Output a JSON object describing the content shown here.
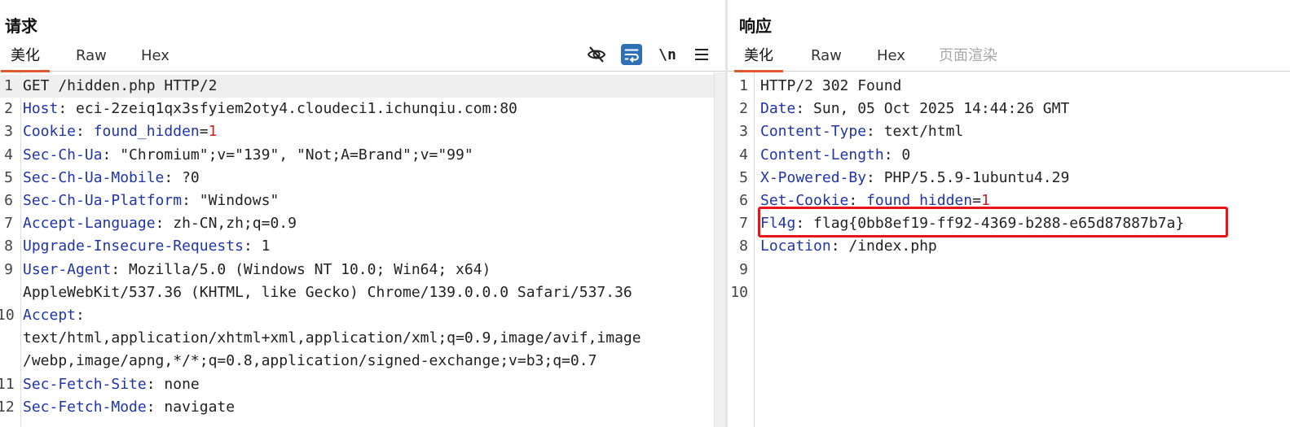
{
  "request": {
    "title": "请求",
    "tabs": [
      {
        "label": "美化",
        "active": true
      },
      {
        "label": "Raw",
        "active": false
      },
      {
        "label": "Hex",
        "active": false
      }
    ],
    "tools": {
      "wrap_newline": "\\n"
    },
    "lines": [
      {
        "num": "1",
        "name": "",
        "value": "GET /hidden.php HTTP/2"
      },
      {
        "num": "2",
        "name": "Host",
        "value": ": eci-2zeiq1qx3sfyiem2oty4.cloudeci1.ichunqiu.com:80"
      },
      {
        "num": "3",
        "name": "Cookie",
        "value": ": ",
        "cookie_name": "found_hidden",
        "cookie_eq": "=",
        "cookie_value": "1"
      },
      {
        "num": "4",
        "name": "Sec-Ch-Ua",
        "value": ": \"Chromium\";v=\"139\", \"Not;A=Brand\";v=\"99\""
      },
      {
        "num": "5",
        "name": "Sec-Ch-Ua-Mobile",
        "value": ": ?0"
      },
      {
        "num": "6",
        "name": "Sec-Ch-Ua-Platform",
        "value": ": \"Windows\""
      },
      {
        "num": "7",
        "name": "Accept-Language",
        "value": ": zh-CN,zh;q=0.9"
      },
      {
        "num": "8",
        "name": "Upgrade-Insecure-Requests",
        "value": ": 1"
      },
      {
        "num": "9",
        "name": "User-Agent",
        "value": ": Mozilla/5.0 (Windows NT 10.0; Win64; x64)",
        "cont": [
          "AppleWebKit/537.36 (KHTML, like Gecko) Chrome/139.0.0.0 Safari/537.36"
        ]
      },
      {
        "num": "10",
        "name": "Accept",
        "value": ":",
        "cont": [
          "text/html,application/xhtml+xml,application/xml;q=0.9,image/avif,image",
          "/webp,image/apng,*/*;q=0.8,application/signed-exchange;v=b3;q=0.7"
        ]
      },
      {
        "num": "11",
        "name": "Sec-Fetch-Site",
        "value": ": none"
      },
      {
        "num": "12",
        "name": "Sec-Fetch-Mode",
        "value": ": navigate"
      }
    ]
  },
  "response": {
    "title": "响应",
    "tabs": [
      {
        "label": "美化",
        "active": true
      },
      {
        "label": "Raw",
        "active": false
      },
      {
        "label": "Hex",
        "active": false
      },
      {
        "label": "页面渲染",
        "active": false,
        "disabled": true
      }
    ],
    "lines": [
      {
        "num": "1",
        "name": "",
        "value": "HTTP/2 302 Found"
      },
      {
        "num": "2",
        "name": "Date",
        "value": ": Sun, 05 Oct 2025 14:44:26 GMT"
      },
      {
        "num": "3",
        "name": "Content-Type",
        "value": ": text/html"
      },
      {
        "num": "4",
        "name": "Content-Length",
        "value": ": 0"
      },
      {
        "num": "5",
        "name": "X-Powered-By",
        "value": ": PHP/5.5.9-1ubuntu4.29"
      },
      {
        "num": "6",
        "name": "Set-Cookie",
        "value": ": ",
        "cookie_name": "found_hidden",
        "cookie_eq": "=",
        "cookie_value": "1"
      },
      {
        "num": "7",
        "name": "Fl4g",
        "value": ": flag{0bb8ef19-ff92-4369-b288-e65d87887b7a}",
        "highlighted": true
      },
      {
        "num": "8",
        "name": "Location",
        "value": ": /index.php"
      },
      {
        "num": "9",
        "name": "",
        "value": ""
      },
      {
        "num": "10",
        "name": "",
        "value": ""
      }
    ]
  },
  "colors": {
    "header_name": "#1f35a8",
    "cookie_value": "#c62222",
    "highlight": "#e8141a",
    "tab_accent": "#e0592e"
  }
}
